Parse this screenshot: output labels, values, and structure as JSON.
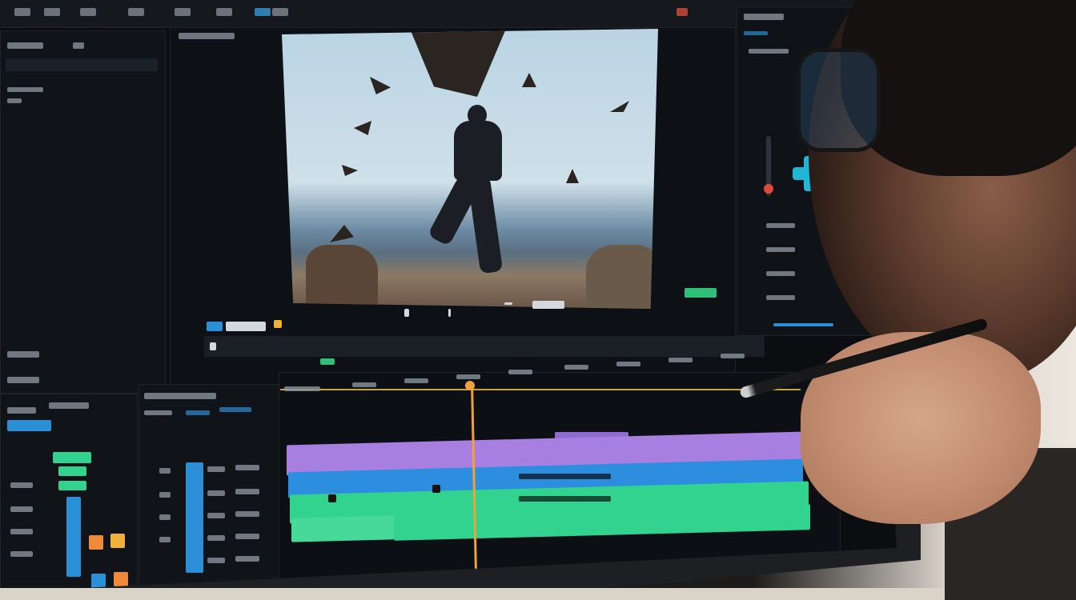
{
  "scene": {
    "subject": "",
    "colors": {
      "clip_purple": "#a77fe0",
      "clip_blue": "#2d8ee0",
      "clip_green": "#31d38f",
      "playhead": "#f0a23a",
      "accent": "#1fb6d8"
    },
    "icons": [
      "play-icon",
      "pen-icon",
      "joystick-icon"
    ]
  }
}
